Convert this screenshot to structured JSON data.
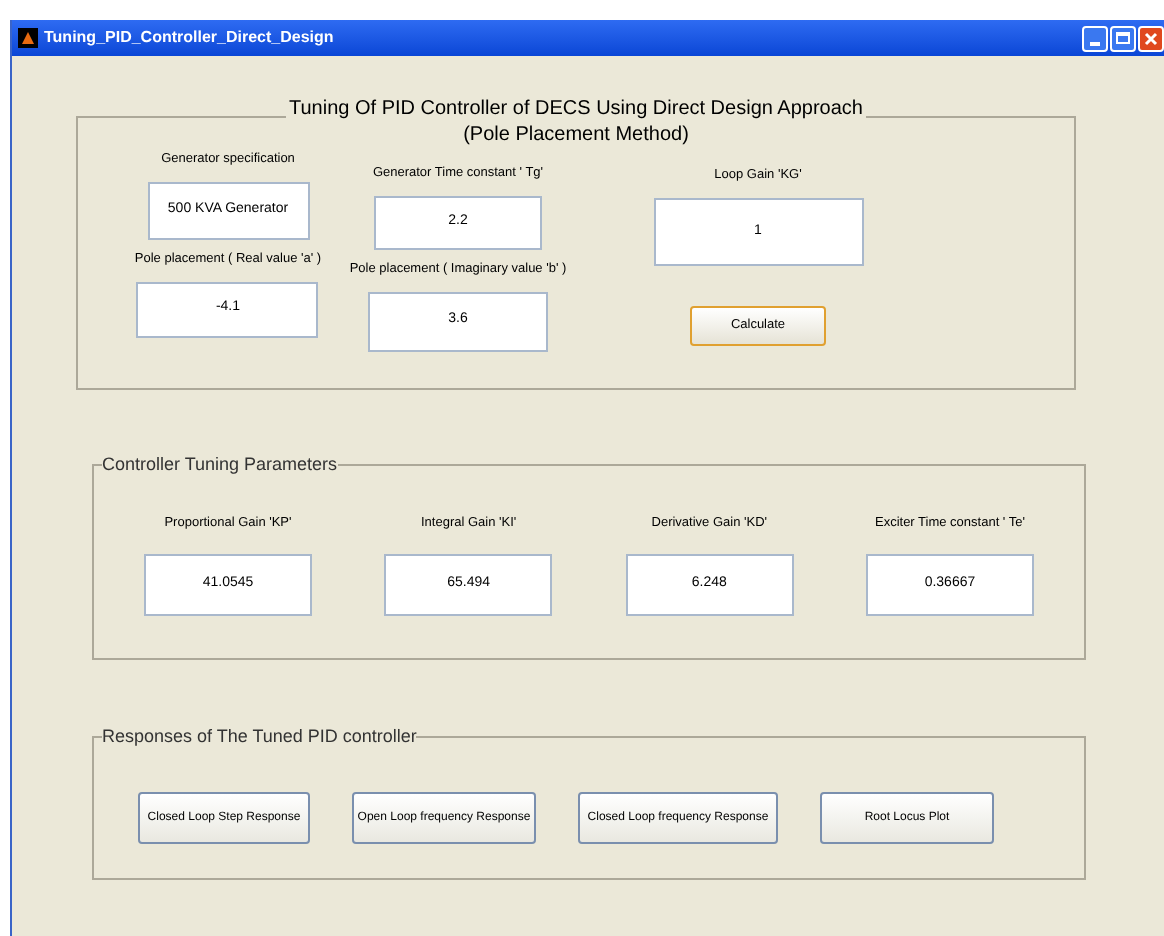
{
  "window": {
    "title": "Tuning_PID_Controller_Direct_Design"
  },
  "heading": {
    "line_1": "Tuning Of PID Controller of DECS Using Direct Design Approach",
    "line_2": "(Pole Placement Method)"
  },
  "inputs": {
    "columns": [
      [
        {
          "label": "Generator specification",
          "value": "500 KVA Generator"
        },
        {
          "label": "Pole placement ( Real value 'a' )",
          "value": "-4.1"
        }
      ],
      [
        {
          "label": "Generator Time constant ' Tg'",
          "value": "2.2"
        },
        {
          "label": "Pole placement ( Imaginary value 'b' )",
          "value": "3.6"
        }
      ],
      [
        {
          "label": "Loop Gain 'KG'",
          "value": "1"
        }
      ]
    ],
    "button": "Calculate"
  },
  "tuning": {
    "title": "Controller Tuning Parameters",
    "params": [
      {
        "label": "Proportional Gain 'KP'",
        "value": "41.0545"
      },
      {
        "label": "Integral Gain 'KI'",
        "value": "65.494"
      },
      {
        "label": "Derivative Gain 'KD'",
        "value": "6.248"
      },
      {
        "label": "Exciter Time constant ' Te'",
        "value": "0.36667"
      }
    ]
  },
  "responses": {
    "title": "Responses of The Tuned PID controller",
    "buttons": [
      "Closed Loop Step Response",
      "Open Loop frequency Response",
      "Closed Loop frequency Response",
      "Root Locus Plot"
    ]
  }
}
